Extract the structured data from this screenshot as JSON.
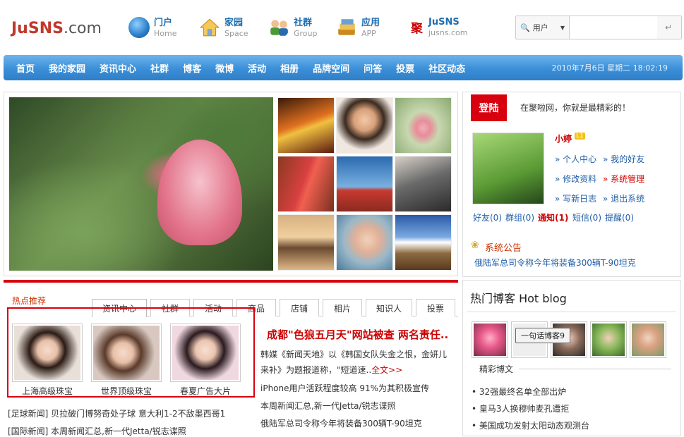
{
  "brand": {
    "logo_main": "JuSNS",
    "logo_suffix": ".com"
  },
  "topnav": [
    {
      "title": "门户",
      "sub": "Home",
      "icon": "globe-icon",
      "color": "#2a7cc7"
    },
    {
      "title": "家园",
      "sub": "Space",
      "icon": "house-icon",
      "color": "#f0a830"
    },
    {
      "title": "社群",
      "sub": "Group",
      "icon": "people-icon",
      "color": "#4a9a3a"
    },
    {
      "title": "应用",
      "sub": "APP",
      "icon": "stack-icon",
      "color": "#d8a030"
    },
    {
      "title": "JuSNS",
      "sub": "jusns.com",
      "icon": "ju-icon",
      "color": "#cc0000",
      "glyph": "聚"
    }
  ],
  "search": {
    "scope": "用户",
    "placeholder": "",
    "go": "↵"
  },
  "mainnav": {
    "items": [
      "首页",
      "我的家园",
      "资讯中心",
      "社群",
      "博客",
      "微博",
      "活动",
      "相册",
      "品牌空间",
      "问答",
      "投票",
      "社区动态"
    ],
    "date": "2010年7月6日 星期二 18:02:19"
  },
  "user": {
    "login": "登陆",
    "welcome": "在聚啦网，你就是最精彩的！",
    "name": "小婷",
    "level": "L1",
    "links": [
      "个人中心",
      "我的好友",
      "修改资料",
      "系统管理",
      "写新日志",
      "退出系统"
    ],
    "stats": [
      "好友(0)",
      "群组(0)",
      "通知(1)",
      "短信(0)",
      "提醒(0)"
    ],
    "notice_title": "系统公告",
    "notice_body": "俄陆军总司令称今年将装备300辆T-90坦克"
  },
  "hot": {
    "title": "热点推荐",
    "tabs": [
      "资讯中心",
      "社群",
      "活动",
      "商品",
      "店铺",
      "相片",
      "知识人",
      "投票"
    ],
    "photos": [
      "上海高级珠宝",
      "世界顶级珠宝",
      "春夏广告大片"
    ]
  },
  "news": {
    "headline": "成都\"色狼五月天\"网站被查 两名责任..",
    "lead": "韩媒《新闻天地》以《韩国女队失金之恨，金妍儿来补》为题报道称，\"短道速..",
    "more": "全文>>",
    "items": [
      "iPhone用户活跃程度较高 91%为其积极宣传",
      "本周新闻汇总,新一代Jetta/锐志谍照",
      "俄陆军总司令称今年将装备300辆T-90坦克"
    ],
    "left_items": [
      "[足球新闻] 贝拉破门博努奇处子球 意大利1-2不敌墨西哥1",
      "[国际新闻] 本周新闻汇总,新一代Jetta/锐志谍照"
    ]
  },
  "blog": {
    "title": "热门博客 Hot blog",
    "tooltip": "一句话博客9",
    "section": "精彩博文",
    "items": [
      "• 32强最终名单全部出炉",
      "• 皇马3人换穆帅麦孔遭拒",
      "• 美国成功发射太阳动态观测台"
    ]
  }
}
